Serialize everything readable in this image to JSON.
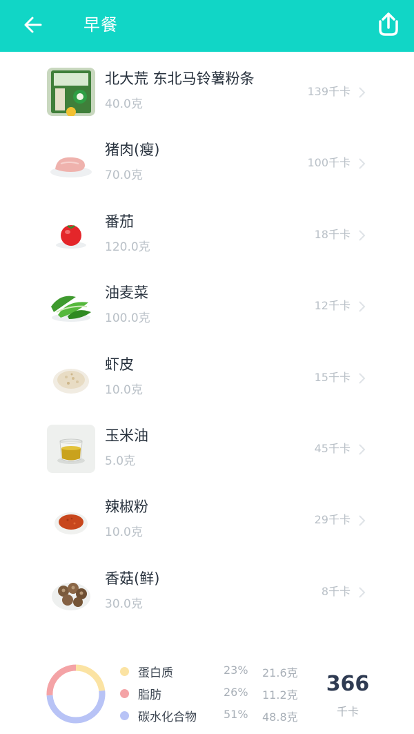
{
  "header": {
    "title": "早餐",
    "back_icon": "arrow-left-icon",
    "share_icon": "share-upload-icon",
    "bg_color": "#11d6c6"
  },
  "foods": [
    {
      "name": "北大荒 东北马铃薯粉条",
      "weight": "40.0克",
      "kcal": "139千卡",
      "icon": "noodle-package-thumb"
    },
    {
      "name": "猪肉(瘦)",
      "weight": "70.0克",
      "kcal": "100千卡",
      "icon": "lean-pork-thumb"
    },
    {
      "name": "番茄",
      "weight": "120.0克",
      "kcal": "18千卡",
      "icon": "tomato-thumb"
    },
    {
      "name": "油麦菜",
      "weight": "100.0克",
      "kcal": "12千卡",
      "icon": "lettuce-thumb"
    },
    {
      "name": "虾皮",
      "weight": "10.0克",
      "kcal": "15千卡",
      "icon": "dried-shrimp-thumb"
    },
    {
      "name": "玉米油",
      "weight": "5.0克",
      "kcal": "45千卡",
      "icon": "corn-oil-thumb"
    },
    {
      "name": "辣椒粉",
      "weight": "10.0克",
      "kcal": "29千卡",
      "icon": "chili-powder-thumb"
    },
    {
      "name": "香菇(鲜)",
      "weight": "30.0克",
      "kcal": "8千卡",
      "icon": "shiitake-thumb"
    }
  ],
  "summary": {
    "macros": [
      {
        "name": "蛋白质",
        "percent": "23%",
        "grams": "21.6克",
        "color": "#fbe3a3",
        "fraction": 0.23
      },
      {
        "name": "脂肪",
        "percent": "26%",
        "grams": "11.2克",
        "color": "#f4a3a6",
        "fraction": 0.26
      },
      {
        "name": "碳水化合物",
        "percent": "51%",
        "grams": "48.8克",
        "color": "#b8c3f6",
        "fraction": 0.51
      }
    ],
    "total_kcal": "366",
    "total_unit": "千卡"
  }
}
